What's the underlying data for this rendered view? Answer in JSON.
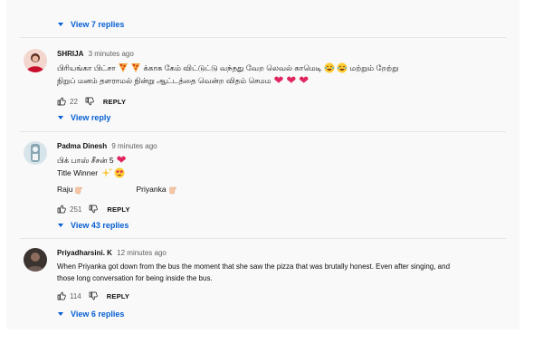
{
  "top_replies": {
    "label": "View 7 replies"
  },
  "comments": [
    {
      "author": "SHRIJA",
      "time": "3 minutes ago",
      "line1_a": "பிரியங்கா பிட்சா",
      "line1_b": "க்காக கேம் விட்டுட்டு வந்தது வேற லெவல் காமெடி",
      "line1_c": "மற்றும் றேற்று",
      "line2": "நிறுப் மனம் தளராமல் நின்று ஆட்டத்தை வென்ற விதம் செமம",
      "likes": "22",
      "reply_label": "REPLY",
      "replies_label": "View reply"
    },
    {
      "author": "Padma Dinesh",
      "time": "9 minutes ago",
      "line1": "பிக் பாஸ் சீசன் 5",
      "line2": "Title Winner",
      "name_a": "Raju",
      "name_b": "Priyanka",
      "likes": "251",
      "reply_label": "REPLY",
      "replies_label": "View 43 replies"
    },
    {
      "author": "Priyadharsini. K",
      "time": "12 minutes ago",
      "line1": "When Priyanka got down from the bus the moment that she saw the pizza that was brutally honest. Even after singing, and",
      "line2": "those long conversation for being inside the bus.",
      "likes": "114",
      "reply_label": "REPLY",
      "replies_label": "View 6 replies"
    }
  ],
  "colors": {
    "link": "#065fd4",
    "heart": "#e0245e",
    "meta": "#606060",
    "panel": "#f9f9f9"
  },
  "icons": [
    "chevron-down-icon",
    "thumb-up-icon",
    "thumb-down-icon",
    "pizza-emoji",
    "laughing-emoji",
    "heart-emoji",
    "sparkles-emoji",
    "heart-eyes-emoji",
    "pointing-hand-emoji"
  ]
}
